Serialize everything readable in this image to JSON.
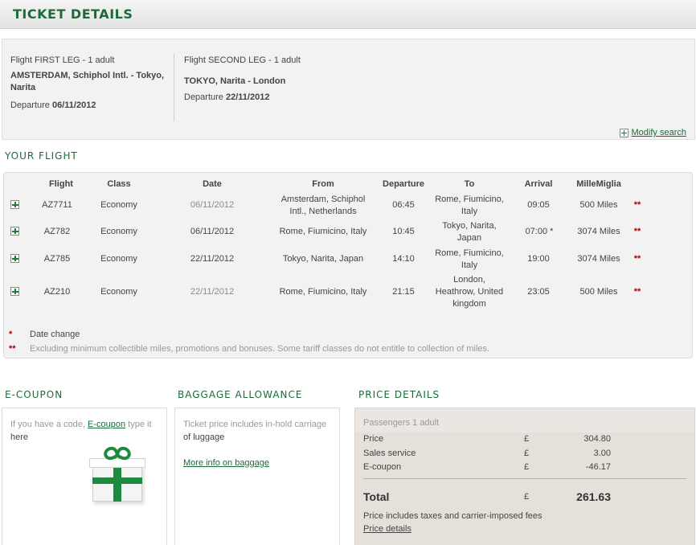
{
  "page": {
    "title": "TICKET DETAILS"
  },
  "legs": [
    {
      "title": "Flight FIRST LEG - 1 adult",
      "route_line1": "AMSTERDAM, Schiphol Intl. - Tokyo,",
      "route_line2": "Narita",
      "departure_label": "Departure ",
      "departure_date": "06/11/2012"
    },
    {
      "title": "Flight SECOND LEG - 1 adult",
      "route_line1": "TOKYO, Narita - London",
      "route_line2": "",
      "departure_label": "Departure ",
      "departure_date": "22/11/2012"
    }
  ],
  "modify_search": "Modify search",
  "your_flight": {
    "title": "YOUR FLIGHT",
    "headers": {
      "flight": "Flight",
      "class": "Class",
      "date": "Date",
      "from": "From",
      "departure": "Departure",
      "to": "To",
      "arrival": "Arrival",
      "miles": "MilleMiglia"
    },
    "rows": [
      {
        "flight": "AZ7711",
        "class": "Economy",
        "date": "06/11/2012",
        "from_l1": "Amsterdam, Schiphol",
        "from_l2": "Intl., Netherlands",
        "departure": "06:45",
        "to_l1": "Rome, Fiumicino,",
        "to_l2": "Italy",
        "to_l3": "",
        "arrival": "09:05",
        "miles": "500 Miles",
        "stars": "**"
      },
      {
        "flight": "AZ782",
        "class": "Economy",
        "date": "06/11/2012",
        "from_l1": "Rome, Fiumicino, Italy",
        "from_l2": "",
        "departure": "10:45",
        "to_l1": "Tokyo, Narita,",
        "to_l2": "Japan",
        "to_l3": "",
        "arrival": "07:00 *",
        "miles": "3074 Miles",
        "stars": "**"
      },
      {
        "flight": "AZ785",
        "class": "Economy",
        "date": "22/11/2012",
        "from_l1": "Tokyo, Narita, Japan",
        "from_l2": "",
        "departure": "14:10",
        "to_l1": "Rome, Fiumicino,",
        "to_l2": "Italy",
        "to_l3": "",
        "arrival": "19:00",
        "miles": "3074 Miles",
        "stars": "**"
      },
      {
        "flight": "AZ210",
        "class": "Economy",
        "date": "22/11/2012",
        "from_l1": "Rome, Fiumicino, Italy",
        "from_l2": "",
        "departure": "21:15",
        "to_l1": "London,",
        "to_l2": "Heathrow, United",
        "to_l3": "kingdom",
        "arrival": "23:05",
        "miles": "500 Miles",
        "stars": "**"
      }
    ],
    "notes": [
      {
        "mark": "*",
        "text": "Date change"
      },
      {
        "mark": "**",
        "text": "Excluding minimum collectible miles, promotions and bonuses. Some tariff classes do not entitle to collection of miles."
      }
    ]
  },
  "ecoupon": {
    "title": "E-COUPON",
    "text_before": "If you have a code, ",
    "link": "E-coupon",
    "text_after": " type it",
    "text_line2": "here"
  },
  "baggage": {
    "title": "BAGGAGE ALLOWANCE",
    "line1": "Ticket price includes in-hold carriage",
    "line2": "of luggage",
    "link": "More info on baggage"
  },
  "price": {
    "title": "PRICE DETAILS",
    "passengers": "Passengers  1 adult",
    "currency": "£",
    "rows": [
      {
        "label": "Price",
        "amount": "304.80"
      },
      {
        "label": "Sales service",
        "amount": "3.00"
      },
      {
        "label": "E-coupon",
        "amount": "-46.17"
      }
    ],
    "total_label": "Total",
    "total_amount": "261.63",
    "note": "Price includes taxes and carrier-imposed fees",
    "details_link": "Price details"
  }
}
